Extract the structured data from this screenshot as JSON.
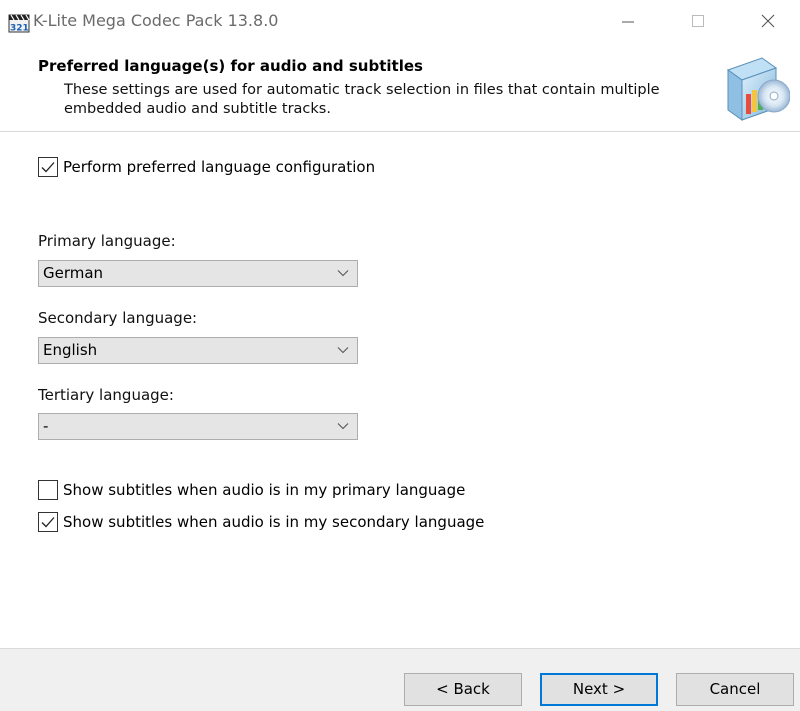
{
  "window": {
    "title": "K-Lite Mega Codec Pack 13.8.0",
    "controls": {
      "minimize": "minimize",
      "maximize": "maximize",
      "close": "close"
    }
  },
  "header": {
    "title": "Preferred language(s) for audio and subtitles",
    "description": "These settings are used for automatic track selection in files that contain multiple embedded audio and subtitle tracks."
  },
  "options": {
    "perform_config": {
      "label": "Perform preferred language configuration",
      "checked": true
    },
    "primary": {
      "label": "Primary language:",
      "value": "German"
    },
    "secondary": {
      "label": "Secondary language:",
      "value": "English"
    },
    "tertiary": {
      "label": "Tertiary language:",
      "value": "-"
    },
    "subs_primary": {
      "label": "Show subtitles when audio is in my primary language",
      "checked": false
    },
    "subs_secondary": {
      "label": "Show subtitles when audio is in my secondary language",
      "checked": true
    }
  },
  "buttons": {
    "back": "< Back",
    "next": "Next >",
    "cancel": "Cancel"
  },
  "colors": {
    "accent": "#0078d7",
    "footer_bg": "#f0f0f0",
    "select_bg": "#e5e5e5"
  }
}
